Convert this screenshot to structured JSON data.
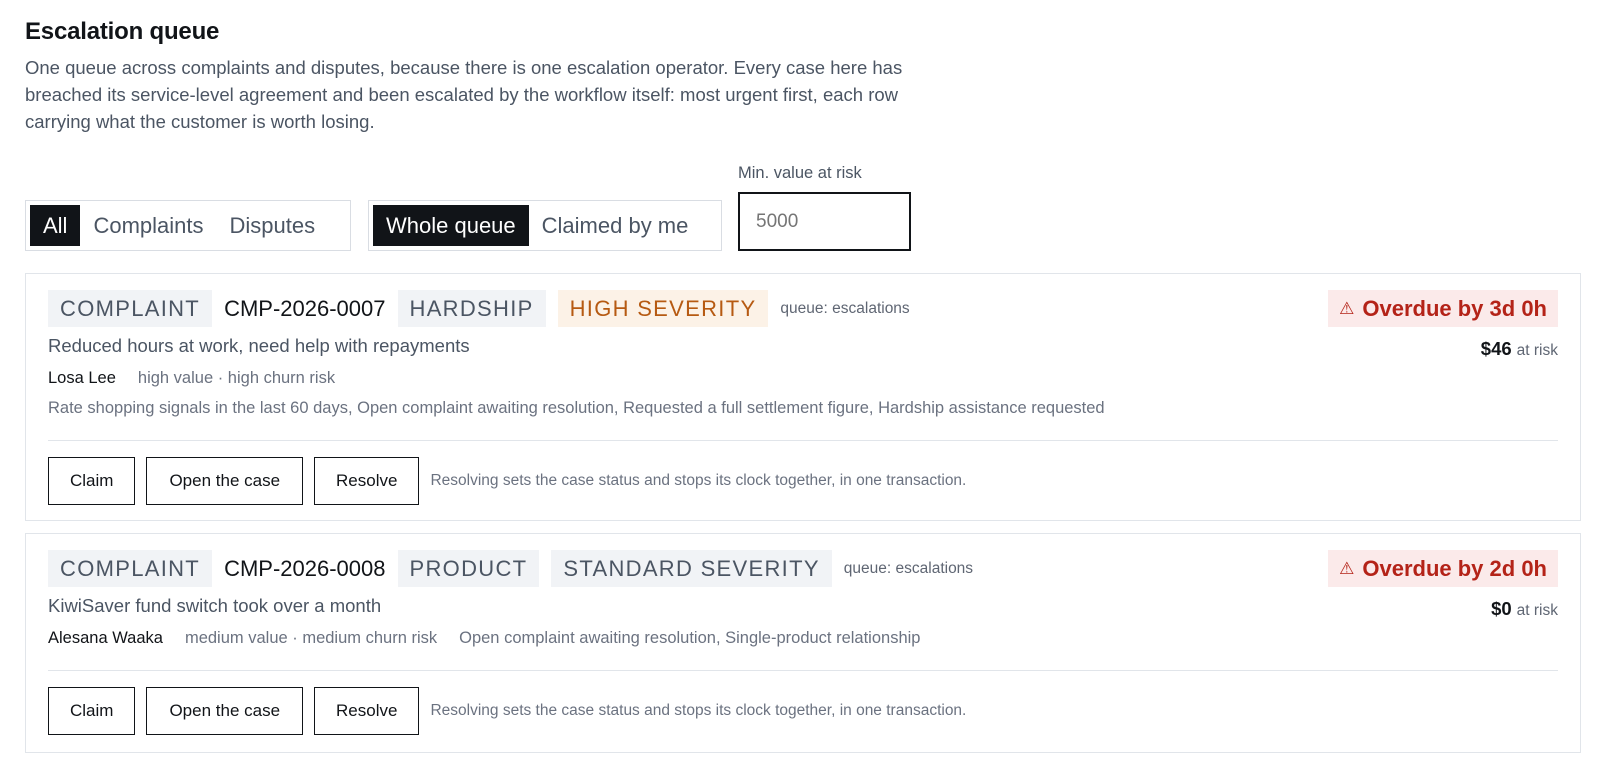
{
  "header": {
    "title": "Escalation queue",
    "description": "One queue across complaints and disputes, because there is one escalation operator. Every case here has breached its service-level agreement and been escalated by the workflow itself: most urgent first, each row carrying what the customer is worth losing."
  },
  "filters": {
    "case_type": {
      "options": [
        "All",
        "Complaints",
        "Disputes"
      ],
      "selected": "All"
    },
    "scope": {
      "options": [
        "Whole queue",
        "Claimed by me"
      ],
      "selected": "Whole queue"
    },
    "min_value_at_risk": {
      "label": "Min. value at risk",
      "value": "",
      "placeholder": "5000"
    }
  },
  "icons": {
    "warning": "warning-icon"
  },
  "cases": [
    {
      "type": "COMPLAINT",
      "id": "CMP-2026-0007",
      "category": "HARDSHIP",
      "severity": "HIGH SEVERITY",
      "queue": "queue: escalations",
      "overdue": "Overdue by 3d 0h",
      "subject": "Reduced hours at work, need help with repayments",
      "at_risk_value": "$46",
      "at_risk_label": "at risk",
      "customer": "Losa Lee",
      "customer_profile": "high value · high churn risk",
      "signals": "Rate shopping signals in the last 60 days, Open complaint awaiting resolution, Requested a full settlement figure, Hardship assistance requested",
      "actions": {
        "claim": "Claim",
        "open": "Open the case",
        "resolve": "Resolve",
        "note": "Resolving sets the case status and stops its clock together, in one transaction."
      }
    },
    {
      "type": "COMPLAINT",
      "id": "CMP-2026-0008",
      "category": "PRODUCT",
      "severity": "STANDARD SEVERITY",
      "queue": "queue: escalations",
      "overdue": "Overdue by 2d 0h",
      "subject": "KiwiSaver fund switch took over a month",
      "at_risk_value": "$0",
      "at_risk_label": "at risk",
      "customer": "Alesana Waaka",
      "customer_profile": "medium value · medium churn risk",
      "signals": "Open complaint awaiting resolution, Single-product relationship",
      "actions": {
        "claim": "Claim",
        "open": "Open the case",
        "resolve": "Resolve",
        "note": "Resolving sets the case status and stops its clock together, in one transaction."
      }
    }
  ],
  "colors": {
    "text": "#111418",
    "muted_text": "#4b5563",
    "border": "#e1e5ea",
    "active_segment": "#111418",
    "severity_high_background": "#fcf2e7",
    "severity_high_text": "#b65a12",
    "overdue_background": "#fbeaea",
    "overdue_text": "#b42318"
  }
}
